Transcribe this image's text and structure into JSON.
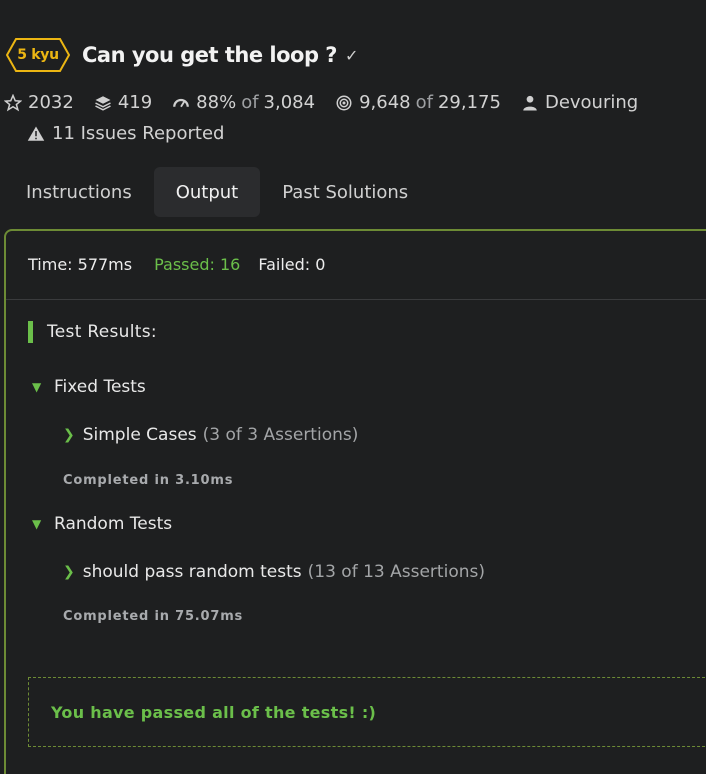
{
  "header": {
    "kyu": "5 kyu",
    "title": "Can you get the loop ?",
    "check_icon": "check-icon"
  },
  "stats": {
    "stars": "2032",
    "collections": "419",
    "satisfaction_pct": "88%",
    "satisfaction_of": "of",
    "satisfaction_votes": "3,084",
    "completed": "9,648",
    "completed_of": "of",
    "attempted": "29,175",
    "author": "Devouring",
    "issues": "11 Issues Reported"
  },
  "tabs": [
    "Instructions",
    "Output",
    "Past Solutions"
  ],
  "active_tab": "Output",
  "summary": {
    "time": "Time: 577ms",
    "passed": "Passed: 16",
    "failed": "Failed: 0"
  },
  "results": {
    "title": "Test Results:",
    "groups": [
      {
        "name": "Fixed Tests",
        "test": "Simple Cases",
        "assertions": "(3 of 3 Assertions)",
        "completed": "Completed in 3.10ms"
      },
      {
        "name": "Random Tests",
        "test": "should pass random tests",
        "assertions": "(13 of 13 Assertions)",
        "completed": "Completed in 75.07ms"
      }
    ],
    "final_message": "You have passed all of the tests! :)"
  },
  "colors": {
    "background": "#1e1f20",
    "kyu_yellow": "#ecb613",
    "pass_green": "#6bbf4a",
    "panel_border": "#6d8b35"
  }
}
